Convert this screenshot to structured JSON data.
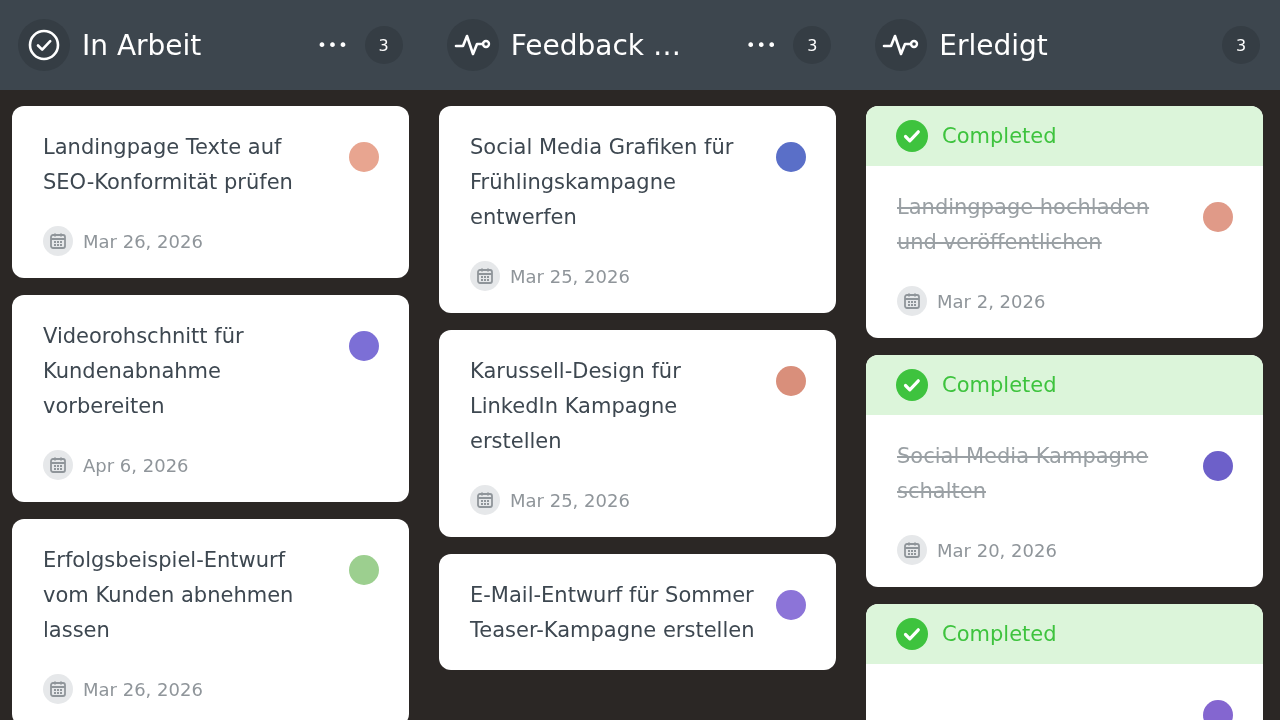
{
  "columns": [
    {
      "title": "In Arbeit",
      "kind": "check",
      "menu_label": "•••",
      "count": "3",
      "cards": [
        {
          "title": "Landingpage Texte auf SEO-Konformität prüfen",
          "date": "Mar 26, 2026",
          "completed": false
        },
        {
          "title": "Videorohschnitt für Kundenabnahme vorbereiten",
          "date": "Apr 6, 2026",
          "completed": false
        },
        {
          "title": "Erfolgsbeispiel-Entwurf vom Kunden abnehmen lassen",
          "date": "Mar 26, 2026",
          "completed": false
        }
      ]
    },
    {
      "title": "Feedback …",
      "kind": "pulse",
      "menu_label": "•••",
      "count": "3",
      "cards": [
        {
          "title": "Social Media Grafiken für Frühlingskampagne entwerfen",
          "date": "Mar 25, 2026",
          "completed": false
        },
        {
          "title": "Karussell-Design für LinkedIn Kampagne erstellen",
          "date": "Mar 25, 2026",
          "completed": false
        },
        {
          "title": "E-Mail-Entwurf für Sommer Teaser-Kampagne erstellen",
          "completed": false
        }
      ]
    },
    {
      "title": "Erledigt",
      "kind": "pulse",
      "count": "3",
      "cards": [
        {
          "status": "Completed",
          "title": "Landingpage hochladen und veröffentlichen",
          "date": "Mar 2, 2026",
          "completed": true
        },
        {
          "status": "Completed",
          "title": "Social Media Kampagne schalten",
          "date": "Mar 20, 2026",
          "completed": true
        },
        {
          "status": "Completed",
          "completed": true
        }
      ]
    }
  ]
}
